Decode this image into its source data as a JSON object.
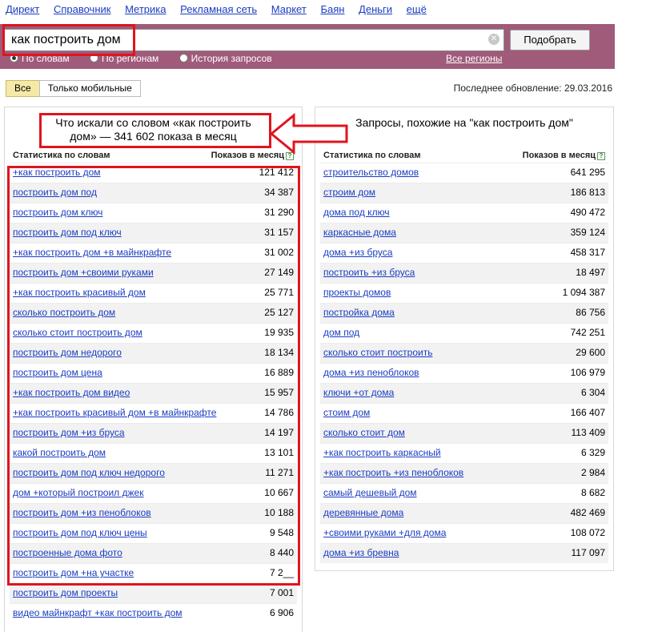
{
  "nav": [
    "Директ",
    "Справочник",
    "Метрика",
    "Рекламная сеть",
    "Маркет",
    "Баян",
    "Деньги",
    "ещё"
  ],
  "search": {
    "value": "как построить дом",
    "button": "Подобрать",
    "clear_icon": "close-circle-icon"
  },
  "radios": [
    {
      "label": "По словам",
      "checked": true
    },
    {
      "label": "По регионам",
      "checked": false
    },
    {
      "label": "История запросов",
      "checked": false
    }
  ],
  "regions_link": "Все регионы",
  "tabs": [
    {
      "label": "Все",
      "active": true
    },
    {
      "label": "Только мобильные",
      "active": false
    }
  ],
  "updated": "Последнее обновление: 29.03.2016",
  "left": {
    "title_line1": "Что искали со словом «как построить",
    "title_line2": "дом» — 341 602 показа в месяц",
    "col_words": "Статистика по словам",
    "col_count": "Показов в месяц",
    "rows": [
      [
        "+как построить дом",
        "121 412"
      ],
      [
        "построить дом под",
        "34 387"
      ],
      [
        "построить дом ключ",
        "31 290"
      ],
      [
        "построить дом под ключ",
        "31 157"
      ],
      [
        "+как построить дом +в майнкрафте",
        "31 002"
      ],
      [
        "построить дом +своими руками",
        "27 149"
      ],
      [
        "+как построить красивый дом",
        "25 771"
      ],
      [
        "сколько построить дом",
        "25 127"
      ],
      [
        "сколько стоит построить дом",
        "19 935"
      ],
      [
        "построить дом недорого",
        "18 134"
      ],
      [
        "построить дом цена",
        "16 889"
      ],
      [
        "+как построить дом видео",
        "15 957"
      ],
      [
        "+как построить красивый дом +в майнкрафте",
        "14 786"
      ],
      [
        "построить дом +из бруса",
        "14 197"
      ],
      [
        "какой построить дом",
        "13 101"
      ],
      [
        "построить дом под ключ недорого",
        "11 271"
      ],
      [
        "дом +который построил джек",
        "10 667"
      ],
      [
        "построить дом +из пеноблоков",
        "10 188"
      ],
      [
        "построить дом под ключ цены",
        "9 548"
      ],
      [
        "построенные дома фото",
        "8 440"
      ],
      [
        "построить дом +на участке",
        "7 2__"
      ],
      [
        "построить дом проекты",
        "7 001"
      ],
      [
        "видео майнкрафт +как построить дом",
        "6 906"
      ]
    ]
  },
  "right": {
    "title": "Запросы, похожие на \"как построить дом\"",
    "col_words": "Статистика по словам",
    "col_count": "Показов в месяц",
    "rows": [
      [
        "строительство домов",
        "641 295"
      ],
      [
        "строим дом",
        "186 813"
      ],
      [
        "дома под ключ",
        "490 472"
      ],
      [
        "каркасные дома",
        "359 124"
      ],
      [
        "дома +из бруса",
        "458 317"
      ],
      [
        "построить +из бруса",
        "18 497"
      ],
      [
        "проекты домов",
        "1 094 387"
      ],
      [
        "постройка дома",
        "86 756"
      ],
      [
        "дом под",
        "742 251"
      ],
      [
        "сколько стоит построить",
        "29 600"
      ],
      [
        "дома +из пеноблоков",
        "106 979"
      ],
      [
        "ключи +от дома",
        "6 304"
      ],
      [
        "стоим дом",
        "166 407"
      ],
      [
        "сколько стоит дом",
        "113 409"
      ],
      [
        "+как построить каркасный",
        "6 329"
      ],
      [
        "+как построить +из пеноблоков",
        "2 984"
      ],
      [
        "самый дешевый дом",
        "8 682"
      ],
      [
        "деревянные дома",
        "482 469"
      ],
      [
        "+своими руками +для дома",
        "108 072"
      ],
      [
        "дома +из бревна",
        "117 097"
      ]
    ]
  },
  "colors": {
    "band": "#a05b7a",
    "link": "#1a3dc1",
    "annotation": "#e0141e",
    "active_tab": "#f5e9a8"
  }
}
